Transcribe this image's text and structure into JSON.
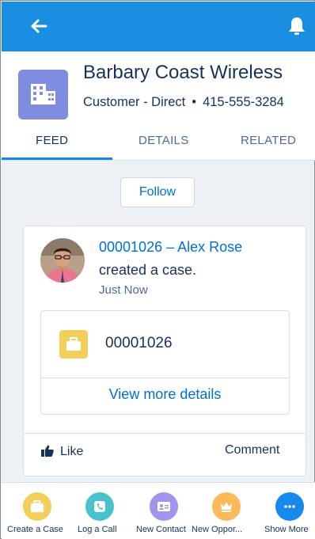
{
  "topbar": {
    "back_icon": "arrow-left-icon",
    "notification_icon": "bell-icon",
    "color": "#1a8ee0"
  },
  "record": {
    "icon": "account-building-icon",
    "icon_color": "#7f8de1",
    "name": "Barbary Coast Wireless",
    "type": "Customer - Direct",
    "separator": "•",
    "phone": "415-555-3284"
  },
  "tabs": [
    {
      "label": "FEED",
      "active": true
    },
    {
      "label": "DETAILS",
      "active": false
    },
    {
      "label": "RELATED",
      "active": false
    }
  ],
  "follow_label": "Follow",
  "feed_item": {
    "title": "00001026 – Alex Rose",
    "action": "created a case.",
    "time": "Just Now",
    "case_icon": "briefcase-icon",
    "case_icon_color": "#f2cf5b",
    "case_number": "00001026",
    "view_more": "View more details",
    "like_label": "Like",
    "like_icon": "thumbs-up-icon",
    "comment_label": "Comment"
  },
  "actions": [
    {
      "label": "Create a Case",
      "icon": "briefcase-icon",
      "color": "#f2cf5b"
    },
    {
      "label": "Log a Call",
      "icon": "phone-icon",
      "color": "#48c3cc"
    },
    {
      "label": "New Contact",
      "icon": "contact-card-icon",
      "color": "#a094ed"
    },
    {
      "label": "New Oppor...",
      "icon": "crown-icon",
      "color": "#fcb95b"
    },
    {
      "label": "Show More",
      "icon": "more-icon",
      "color": "#1589ee"
    }
  ]
}
